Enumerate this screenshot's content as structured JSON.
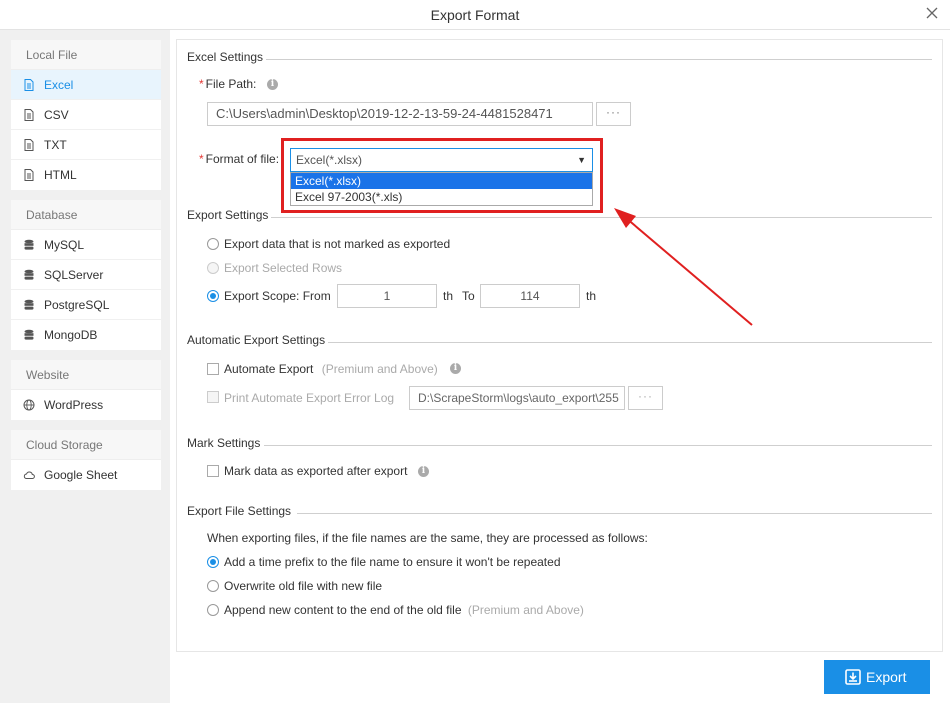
{
  "window": {
    "title": "Export Format"
  },
  "sidebar": {
    "groups": [
      {
        "title": "Local File",
        "items": [
          {
            "label": "Excel",
            "icon": "file-icon",
            "active": true
          },
          {
            "label": "CSV",
            "icon": "file-icon"
          },
          {
            "label": "TXT",
            "icon": "file-icon"
          },
          {
            "label": "HTML",
            "icon": "file-icon"
          }
        ]
      },
      {
        "title": "Database",
        "items": [
          {
            "label": "MySQL",
            "icon": "database-icon"
          },
          {
            "label": "SQLServer",
            "icon": "database-icon"
          },
          {
            "label": "PostgreSQL",
            "icon": "database-icon"
          },
          {
            "label": "MongoDB",
            "icon": "database-icon"
          }
        ]
      },
      {
        "title": "Website",
        "items": [
          {
            "label": "WordPress",
            "icon": "globe-icon"
          }
        ]
      },
      {
        "title": "Cloud Storage",
        "items": [
          {
            "label": "Google Sheet",
            "icon": "cloud-icon"
          }
        ]
      }
    ]
  },
  "excel_settings": {
    "title": "Excel Settings",
    "file_path_label": "File Path:",
    "file_path_value": "C:\\Users\\admin\\Desktop\\2019-12-2-13-59-24-4481528471",
    "browse_label": "···",
    "format_label": "Format of file:",
    "format_value": "Excel(*.xlsx)",
    "format_options": [
      "Excel(*.xlsx)",
      "Excel 97-2003(*.xls)"
    ]
  },
  "export_settings": {
    "title": "Export Settings",
    "option_unmarked": "Export data that is not marked as exported",
    "option_selected_rows": "Export Selected Rows",
    "option_scope": "Export Scope: From",
    "scope_from": "1",
    "scope_th1": "th",
    "scope_to_label": "To",
    "scope_to": "114",
    "scope_th2": "th"
  },
  "automatic_settings": {
    "title": "Automatic Export Settings",
    "automate_label": "Automate Export",
    "automate_note": "(Premium and Above)",
    "error_log_label": "Print Automate Export Error Log",
    "error_log_path": "D:\\ScrapeStorm\\logs\\auto_export\\255",
    "browse_label": "···"
  },
  "mark_settings": {
    "title": "Mark Settings",
    "mark_label": "Mark data as exported after export"
  },
  "file_settings": {
    "title": "Export File Settings",
    "description": "When exporting files, if the file names are the same, they are processed as follows:",
    "option_prefix": "Add a time prefix to the file name to ensure it won't be repeated",
    "option_overwrite": "Overwrite old file with new file",
    "option_append": "Append new content to the end of the old file",
    "append_note": "(Premium and Above)"
  },
  "footer": {
    "export_label": "Export"
  },
  "colors": {
    "accent": "#1a8fe6",
    "annotation": "#e02020"
  }
}
